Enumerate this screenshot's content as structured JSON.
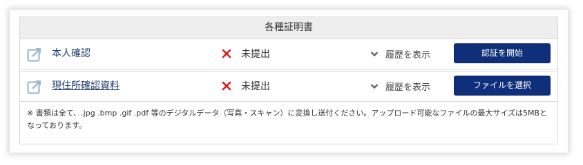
{
  "section_title": "各種証明書",
  "colors": {
    "button_bg": "#0f2f7a",
    "status_x": "#d61a1a",
    "link": "#1f3a6b",
    "header_bg": "#eeeeee"
  },
  "rows": [
    {
      "icon": "edit-external-icon",
      "name": "本人確認",
      "status_icon": "x-icon",
      "status": "未提出",
      "history_label": "履歴を表示",
      "action_label": "認証を開始"
    },
    {
      "icon": "edit-external-icon",
      "name": "現住所確認資料",
      "status_icon": "x-icon",
      "status": "未提出",
      "history_label": "履歴を表示",
      "action_label": "ファイルを選択"
    }
  ],
  "note": "※ 書類は全て、.jpg .bmp .gif .pdf 等のデジタルデータ（写真・スキャン）に変換し送付ください。アップロード可能なファイルの最大サイズは5MBとなっております。"
}
